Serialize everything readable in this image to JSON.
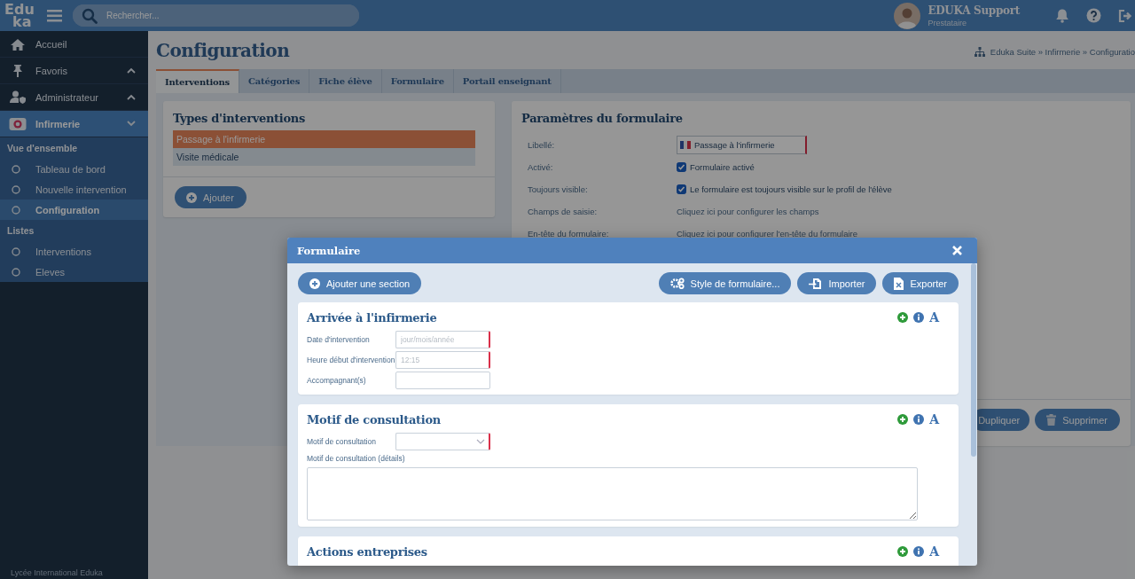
{
  "topbar": {
    "logo_lines": [
      "Edu",
      "ka"
    ],
    "search": {
      "placeholder": "Rechercher..."
    },
    "user": {
      "name": "EDUKA Support",
      "role": "Prestataire"
    }
  },
  "sidebar": {
    "items": [
      {
        "label": "Accueil",
        "kind": "link",
        "selected": false
      },
      {
        "label": "Favoris",
        "kind": "group",
        "expanded": false,
        "selected": false
      },
      {
        "label": "Administrateur",
        "kind": "group",
        "expanded": false,
        "selected": false
      },
      {
        "label": "Infirmerie",
        "kind": "group",
        "expanded": true,
        "selected": true
      }
    ],
    "sections": [
      {
        "title": "Vue d'ensemble",
        "items": [
          {
            "label": "Tableau de bord",
            "selected": false
          },
          {
            "label": "Nouvelle intervention",
            "selected": false
          },
          {
            "label": "Configuration",
            "selected": true
          }
        ]
      },
      {
        "title": "Listes",
        "items": [
          {
            "label": "Interventions",
            "selected": false
          },
          {
            "label": "Eleves",
            "selected": false
          }
        ]
      }
    ],
    "footer": "Lycée International Eduka"
  },
  "page": {
    "title": "Configuration",
    "breadcrumb": "Eduka Suite » Infirmerie » Configuratio"
  },
  "tabs": [
    {
      "label": "Interventions",
      "selected": true
    },
    {
      "label": "Catégories",
      "selected": false
    },
    {
      "label": "Fiche élève",
      "selected": false
    },
    {
      "label": "Formulaire",
      "selected": false
    },
    {
      "label": "Portail enseignant",
      "selected": false
    }
  ],
  "types_card": {
    "title": "Types d'interventions",
    "items": [
      {
        "label": "Passage à l'infirmerie",
        "selected": true
      },
      {
        "label": "Visite médicale",
        "selected": false
      }
    ],
    "button": "Ajouter"
  },
  "params_card": {
    "title": "Paramètres du formulaire",
    "rows": [
      {
        "label": "Libellé:",
        "kind": "input",
        "value": "Passage à l'infirmerie"
      },
      {
        "label": "Activé:",
        "kind": "checkbox",
        "checked": true,
        "text": "Formulaire activé"
      },
      {
        "label": "Toujours visible:",
        "kind": "checkbox",
        "checked": true,
        "text": "Le formulaire est toujours visible sur le profil de l'élève"
      },
      {
        "label": "Champs de saisie:",
        "kind": "link",
        "text": "Cliquez ici pour configurer les champs"
      },
      {
        "label": "En-tête du formulaire:",
        "kind": "link",
        "text": "Cliquez ici pour configurer l'en-tête du formulaire"
      }
    ],
    "buttons": [
      "Dupliquer",
      "Supprimer"
    ]
  },
  "modal": {
    "title": "Formulaire",
    "add_button": "Ajouter une section",
    "buttons": [
      "Style de formulaire...",
      "Importer",
      "Exporter"
    ],
    "sections": [
      {
        "title": "Arrivée à l'infirmerie",
        "style_glyph": "A",
        "fields": [
          {
            "label": "Date d'intervention",
            "kind": "input",
            "placeholder": "jour/mois/année",
            "required": true
          },
          {
            "label": "Heure début d'intervention",
            "kind": "input",
            "placeholder": "12:15",
            "required": true
          },
          {
            "label": "Accompagnant(s)",
            "kind": "input",
            "required": false
          }
        ]
      },
      {
        "title": "Motif de consultation",
        "style_glyph": "A",
        "fields": [
          {
            "label": "Motif de consultation",
            "kind": "select",
            "required": true
          },
          {
            "label": "Motif de consultation (détails)",
            "kind": "textarea",
            "required": false
          }
        ]
      },
      {
        "title": "Actions entreprises",
        "style_glyph": "A"
      }
    ]
  }
}
